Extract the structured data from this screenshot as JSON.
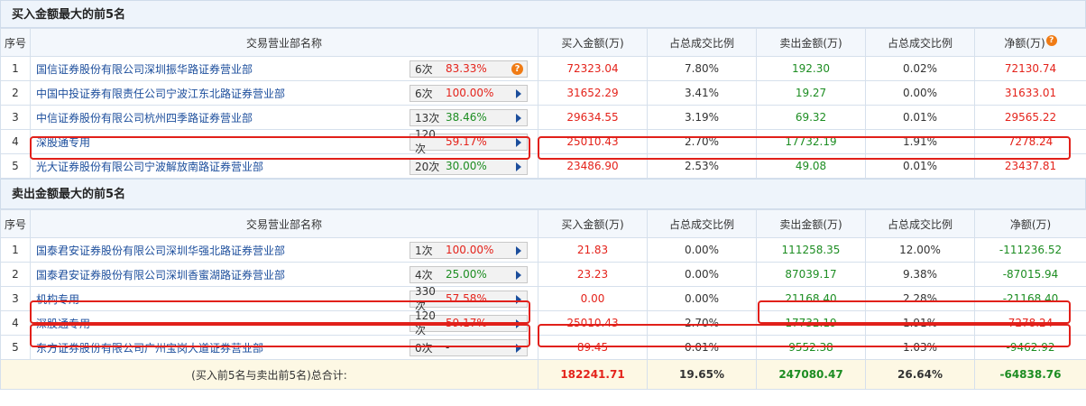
{
  "buy_section": {
    "title": "买入金额最大的前5名",
    "headers": [
      "序号",
      "交易营业部名称",
      "买入金额(万)",
      "占总成交比例",
      "卖出金额(万)",
      "占总成交比例",
      "净额(万)"
    ],
    "rows": [
      {
        "idx": "1",
        "name": "国信证券股份有限公司深圳振华路证券营业部",
        "count": "6次",
        "pct": "83.33%",
        "pct_color": "red",
        "marker": "question",
        "buy": "72323.04",
        "buy_ratio": "7.80%",
        "sell": "192.30",
        "sell_ratio": "0.02%",
        "net": "72130.74",
        "net_color": "red"
      },
      {
        "idx": "2",
        "name": "中国中投证券有限责任公司宁波江东北路证券营业部",
        "count": "6次",
        "pct": "100.00%",
        "pct_color": "red",
        "marker": "arrow",
        "buy": "31652.29",
        "buy_ratio": "3.41%",
        "sell": "19.27",
        "sell_ratio": "0.00%",
        "net": "31633.01",
        "net_color": "red"
      },
      {
        "idx": "3",
        "name": "中信证券股份有限公司杭州四季路证券营业部",
        "count": "13次",
        "pct": "38.46%",
        "pct_color": "green",
        "marker": "arrow",
        "buy": "29634.55",
        "buy_ratio": "3.19%",
        "sell": "69.32",
        "sell_ratio": "0.01%",
        "net": "29565.22",
        "net_color": "red"
      },
      {
        "idx": "4",
        "name": "深股通专用",
        "count": "120次",
        "pct": "59.17%",
        "pct_color": "red",
        "marker": "arrow",
        "buy": "25010.43",
        "buy_ratio": "2.70%",
        "sell": "17732.19",
        "sell_ratio": "1.91%",
        "net": "7278.24",
        "net_color": "red"
      },
      {
        "idx": "5",
        "name": "光大证券股份有限公司宁波解放南路证券营业部",
        "count": "20次",
        "pct": "30.00%",
        "pct_color": "green",
        "marker": "arrow",
        "buy": "23486.90",
        "buy_ratio": "2.53%",
        "sell": "49.08",
        "sell_ratio": "0.01%",
        "net": "23437.81",
        "net_color": "red"
      }
    ]
  },
  "sell_section": {
    "title": "卖出金额最大的前5名",
    "headers": [
      "序号",
      "交易营业部名称",
      "买入金额(万)",
      "占总成交比例",
      "卖出金额(万)",
      "占总成交比例",
      "净额(万)"
    ],
    "rows": [
      {
        "idx": "1",
        "name": "国泰君安证券股份有限公司深圳华强北路证券营业部",
        "count": "1次",
        "pct": "100.00%",
        "pct_color": "red",
        "marker": "arrow",
        "buy": "21.83",
        "buy_ratio": "0.00%",
        "sell": "111258.35",
        "sell_ratio": "12.00%",
        "net": "-111236.52",
        "net_color": "green"
      },
      {
        "idx": "2",
        "name": "国泰君安证券股份有限公司深圳香蜜湖路证券营业部",
        "count": "4次",
        "pct": "25.00%",
        "pct_color": "green",
        "marker": "arrow",
        "buy": "23.23",
        "buy_ratio": "0.00%",
        "sell": "87039.17",
        "sell_ratio": "9.38%",
        "net": "-87015.94",
        "net_color": "green"
      },
      {
        "idx": "3",
        "name": "机构专用",
        "count": "330次",
        "pct": "57.58%",
        "pct_color": "red",
        "marker": "arrow",
        "buy": "0.00",
        "buy_ratio": "0.00%",
        "sell": "21168.40",
        "sell_ratio": "2.28%",
        "net": "-21168.40",
        "net_color": "green"
      },
      {
        "idx": "4",
        "name": "深股通专用",
        "count": "120次",
        "pct": "59.17%",
        "pct_color": "red",
        "marker": "arrow",
        "buy": "25010.43",
        "buy_ratio": "2.70%",
        "sell": "17732.19",
        "sell_ratio": "1.91%",
        "net": "7278.24",
        "net_color": "red"
      },
      {
        "idx": "5",
        "name": "东方证券股份有限公司广州宝岗大道证券营业部",
        "count": "0次",
        "pct": "-",
        "pct_color": "dark",
        "marker": "arrow",
        "buy": "89.45",
        "buy_ratio": "0.01%",
        "sell": "9552.38",
        "sell_ratio": "1.03%",
        "net": "-9462.92",
        "net_color": "green"
      }
    ],
    "total": {
      "label": "(买入前5名与卖出前5名)总合计:",
      "buy": "182241.71",
      "buy_ratio": "19.65%",
      "sell": "247080.47",
      "sell_ratio": "26.64%",
      "net": "-64838.76"
    }
  },
  "colors": {
    "red": "#e4231b",
    "green": "#1d8d22",
    "link": "#1c4e9c",
    "highlight": "#e1201a"
  }
}
